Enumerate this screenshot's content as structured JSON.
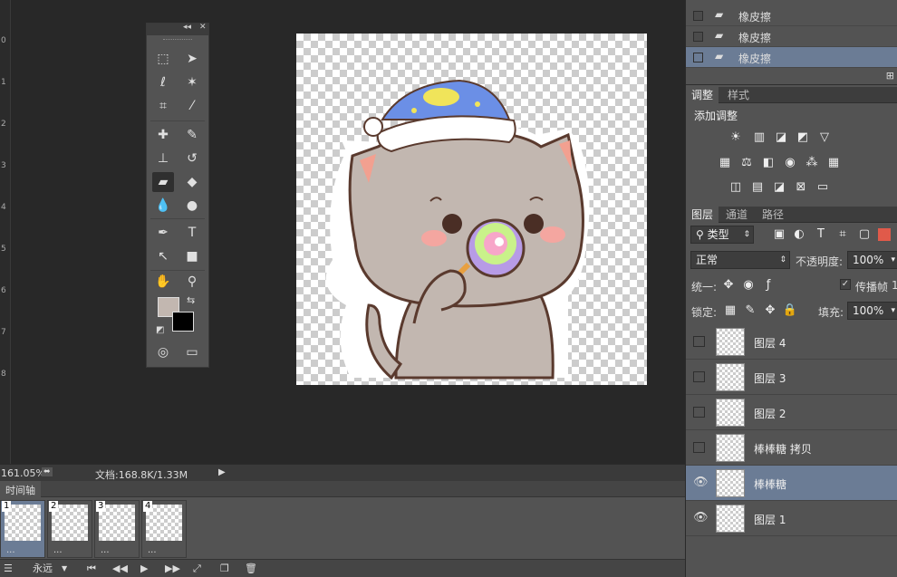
{
  "status": {
    "zoom": "161.05%",
    "doc": "文档:168.8K/1.33M"
  },
  "ruler_marks": [
    "0",
    "1",
    "2",
    "3",
    "4",
    "5",
    "6",
    "7",
    "8"
  ],
  "timeline": {
    "tab": "时间轴",
    "loop": "永远",
    "frames": [
      {
        "num": "1",
        "delay": "..."
      },
      {
        "num": "2",
        "delay": "..."
      },
      {
        "num": "3",
        "delay": "..."
      },
      {
        "num": "4",
        "delay": "..."
      }
    ]
  },
  "history": {
    "items": [
      "橡皮擦",
      "橡皮擦",
      "橡皮擦"
    ]
  },
  "adjust": {
    "tab1": "调整",
    "tab2": "样式",
    "title": "添加调整"
  },
  "layers": {
    "tabs": [
      "图层",
      "通道",
      "路径"
    ],
    "filter": "类型",
    "blend": "正常",
    "opacity_label": "不透明度:",
    "opacity": "100%",
    "unify_label": "统一:",
    "propagate": "传播帧",
    "propagate_num": "1",
    "lock_label": "锁定:",
    "fill_label": "填充:",
    "fill": "100%",
    "items": [
      {
        "name": "图层 4",
        "visible": false
      },
      {
        "name": "图层 3",
        "visible": false
      },
      {
        "name": "图层 2",
        "visible": false
      },
      {
        "name": "棒棒糖 拷贝",
        "visible": false
      },
      {
        "name": "棒棒糖",
        "visible": true,
        "selected": true
      },
      {
        "name": "图层 1",
        "visible": true
      }
    ]
  },
  "colors": {
    "fg": "#c2b7b0",
    "bg": "#000000",
    "accent": "#6b7c95"
  }
}
